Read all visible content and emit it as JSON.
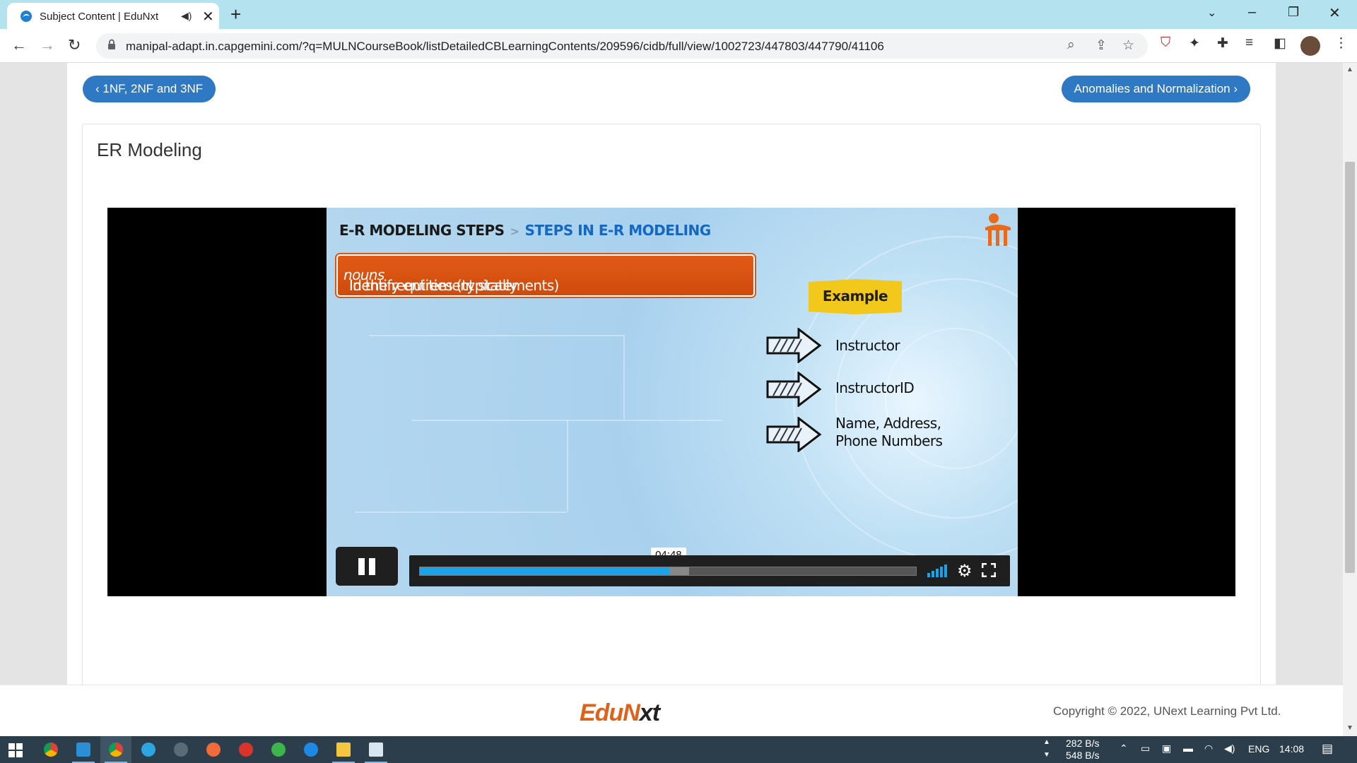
{
  "browser": {
    "tab_title": "Subject Content | EduNxt",
    "url": "manipal-adapt.in.capgemini.com/?q=MULNCourseBook/listDetailedCBLearningContents/209596/cidb/full/view/1002723/447803/447790/41106"
  },
  "nav": {
    "prev_label": "‹ 1NF, 2NF and 3NF",
    "next_label": "Anomalies and Normalization ›"
  },
  "card": {
    "title": "ER Modeling"
  },
  "slide": {
    "heading_main": "E-R MODELING STEPS",
    "heading_separator": ">",
    "heading_sub": "STEPS IN E-R MODELING",
    "box_text_before": "Identify entities (typically ",
    "box_text_italic": "nouns",
    "box_text_after": " in the requirement statements)",
    "example_label": "Example",
    "examples": [
      {
        "line1": "Instructor",
        "line2": ""
      },
      {
        "line1": "InstructorID",
        "line2": ""
      },
      {
        "line1": "Name, Address,",
        "line2": "Phone Numbers"
      }
    ]
  },
  "player": {
    "time_tooltip": "04:48",
    "played_fraction": 0.503,
    "buffered_fraction": 0.543,
    "state": "playing"
  },
  "footer": {
    "logo_part1": "EduN",
    "logo_part2": "xt",
    "copyright": "Copyright © 2022, UNext Learning Pvt Ltd."
  },
  "taskbar": {
    "net_up": "282 B/s",
    "net_down": "548 B/s",
    "lang": "ENG",
    "time": "14:08"
  },
  "colors": {
    "accent_button": "#2f78c3",
    "slide_orange": "#d75618",
    "slide_blue_heading": "#1567c2",
    "progress": "#1aa3e8",
    "example_yellow": "#f2c81c"
  }
}
